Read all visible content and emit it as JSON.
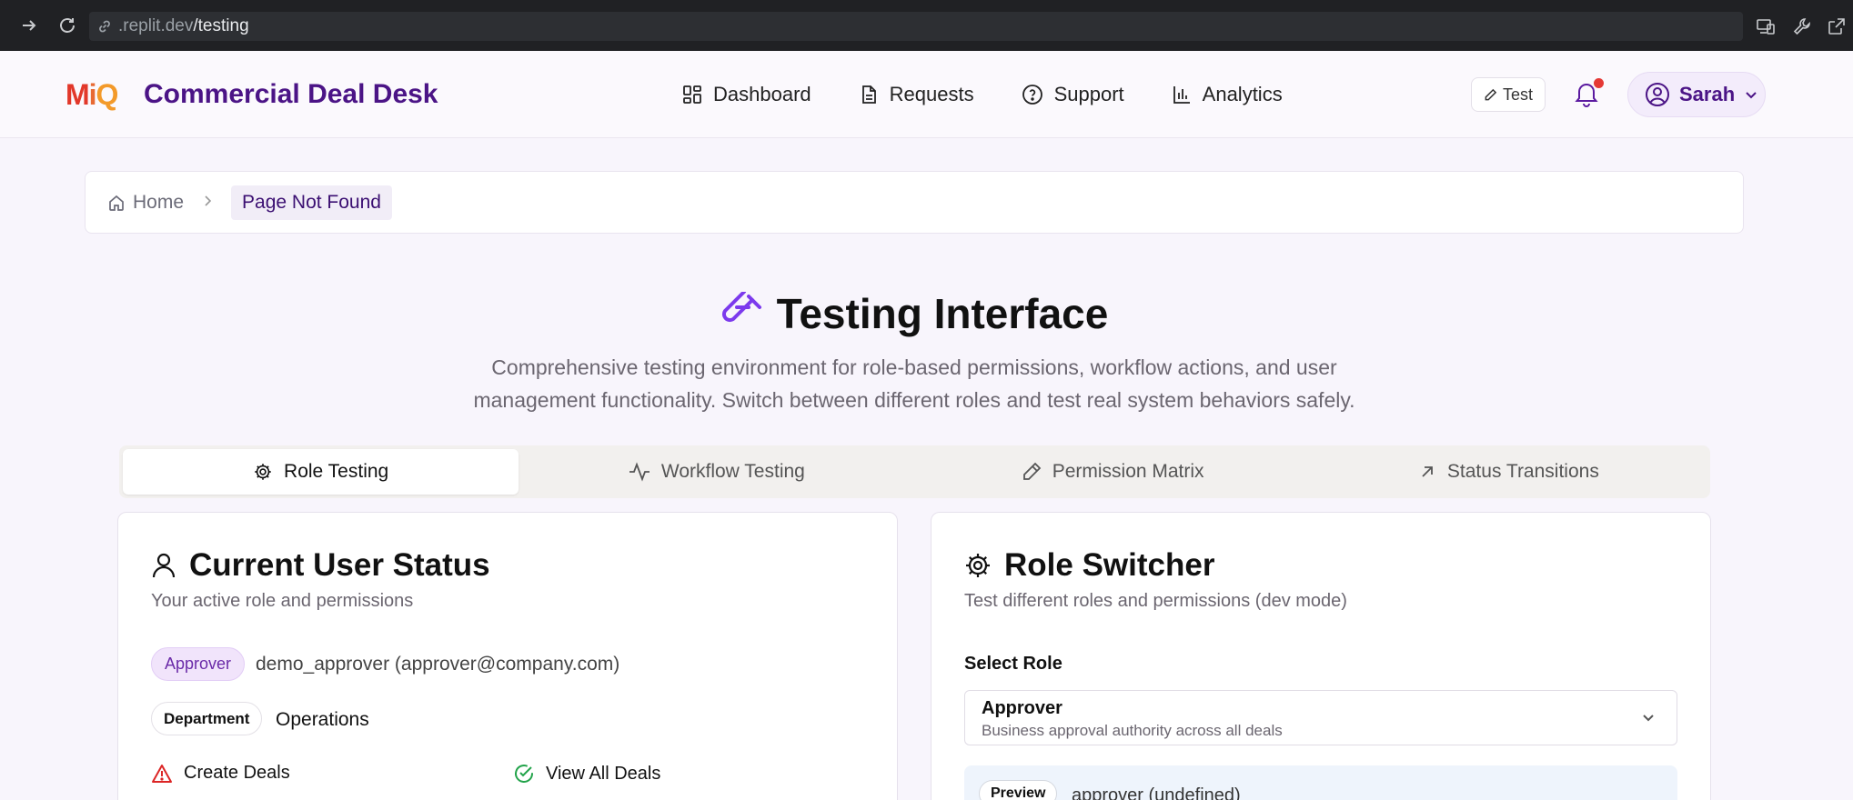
{
  "browser": {
    "url_host": ".replit.dev",
    "url_path": "/testing"
  },
  "header": {
    "logo_m": "M",
    "logo_i": "i",
    "logo_q": "Q",
    "title": "Commercial Deal Desk",
    "nav": [
      {
        "label": "Dashboard",
        "icon": "dashboard-grid-icon"
      },
      {
        "label": "Requests",
        "icon": "document-icon"
      },
      {
        "label": "Support",
        "icon": "help-circle-icon"
      },
      {
        "label": "Analytics",
        "icon": "bar-chart-icon"
      }
    ],
    "test_label": "Test",
    "user_name": "Sarah",
    "notification_dot_color": "#e53935"
  },
  "breadcrumb": {
    "home": "Home",
    "current": "Page Not Found"
  },
  "hero": {
    "title": "Testing Interface",
    "subtitle": "Comprehensive testing environment for role-based permissions, workflow actions, and user management functionality. Switch between different roles and test real system behaviors safely."
  },
  "tabs": [
    {
      "label": "Role Testing",
      "icon": "gear-icon",
      "active": true
    },
    {
      "label": "Workflow Testing",
      "icon": "activity-icon",
      "active": false
    },
    {
      "label": "Permission Matrix",
      "icon": "pencil-icon",
      "active": false
    },
    {
      "label": "Status Transitions",
      "icon": "arrow-up-right-icon",
      "active": false
    }
  ],
  "user_status": {
    "title": "Current User Status",
    "description": "Your active role and permissions",
    "role_badge": "Approver",
    "user": "demo_approver (approver@company.com)",
    "department_label": "Department",
    "department": "Operations",
    "permissions": [
      {
        "label": "Create Deals",
        "granted": false
      },
      {
        "label": "View All Deals",
        "granted": true
      }
    ]
  },
  "role_switcher": {
    "title": "Role Switcher",
    "description": "Test different roles and permissions (dev mode)",
    "select_label": "Select Role",
    "selected_role": "Approver",
    "selected_role_desc": "Business approval authority across all deals",
    "preview_label": "Preview",
    "preview_text": "approver (undefined)"
  },
  "colors": {
    "brand_purple": "#4b1486",
    "accent_violet": "#7c3aed",
    "success_green": "#22a34a",
    "danger_red": "#dc2626"
  }
}
